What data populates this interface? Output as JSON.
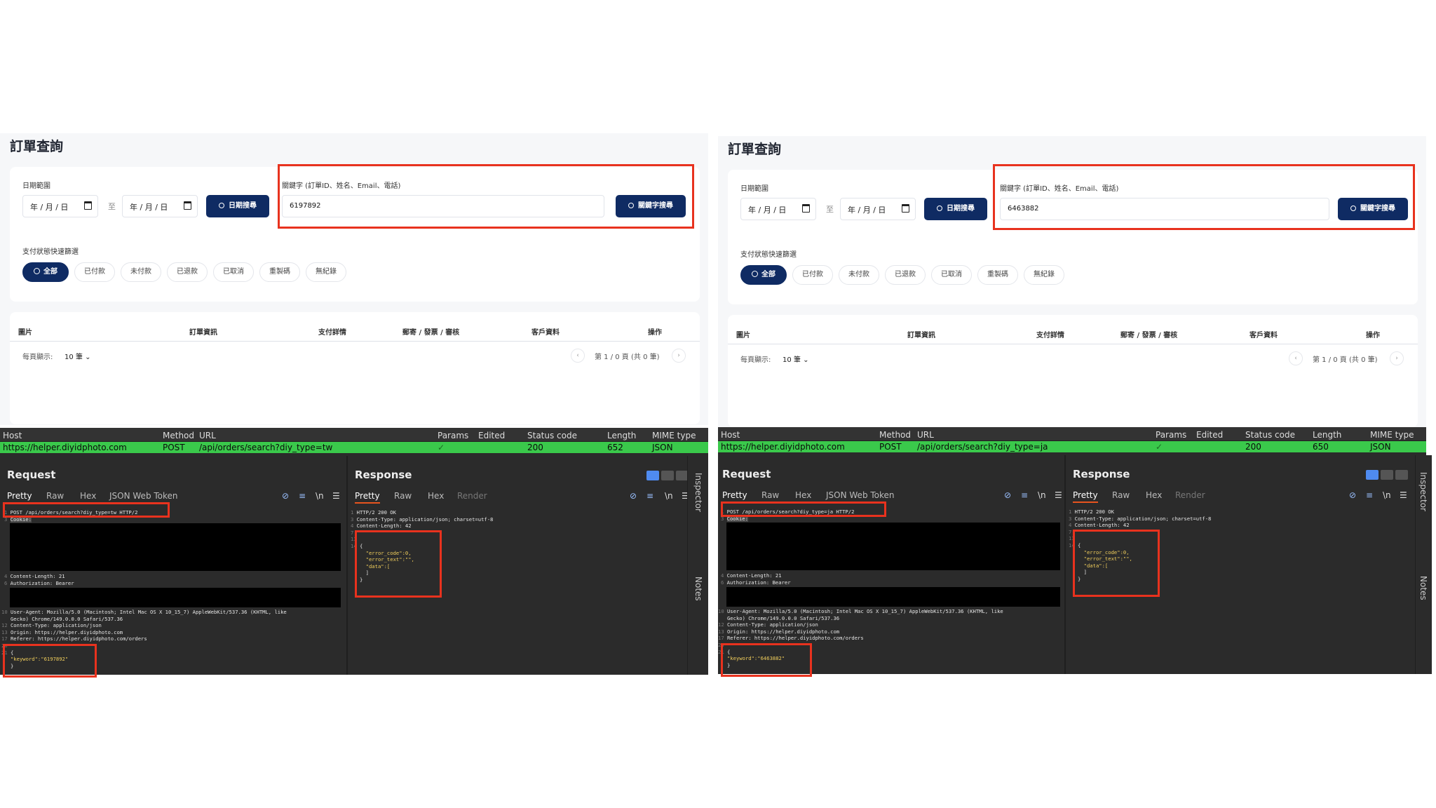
{
  "left": {
    "page_title": "訂單查詢",
    "date_range_label": "日期範圍",
    "date_from": "年 / 月 / 日",
    "date_to": "年 / 月 / 日",
    "range_sep": "至",
    "date_search_btn": "日期搜尋",
    "keyword_label": "關鍵字 (訂單ID、姓名、Email、電話)",
    "keyword_value": "6197892",
    "keyword_search_btn": "關鍵字搜尋",
    "status_filter_label": "支付狀態快速篩選",
    "chips": [
      "全部",
      "已付款",
      "未付款",
      "已退款",
      "已取消",
      "重製碼",
      "無紀錄"
    ],
    "table_headers": [
      "圖片",
      "訂單資訊",
      "支付詳情",
      "郵寄 / 發票 / 審核",
      "客戶資料",
      "操作"
    ],
    "per_page_label": "每頁顯示:",
    "per_page_value": "10 筆",
    "pager_text": "第 1 / 0 頁 (共 0 筆)",
    "grid_headers": [
      "Host",
      "Method",
      "URL",
      "Params",
      "Edited",
      "Status code",
      "Length",
      "MIME type"
    ],
    "grid_row": {
      "host": "https://helper.diyidphoto.com",
      "method": "POST",
      "url": "/api/orders/search?diy_type=tw",
      "params": "✓",
      "status": "200",
      "length": "652",
      "mime": "JSON"
    },
    "request_title": "Request",
    "response_title": "Response",
    "req_tabs": [
      "Pretty",
      "Raw",
      "Hex",
      "JSON Web Token"
    ],
    "resp_tabs": [
      "Pretty",
      "Raw",
      "Hex",
      "Render"
    ],
    "newline_icon": "\\n",
    "req_line1": "POST /api/orders/search?diy_type=tw HTTP/2",
    "req_cookie": "Cookie:",
    "req_len": "Content-Length: 21",
    "req_auth": "Authorization: Bearer",
    "req_ua": "User-Agent: Mozilla/5.0 (Macintosh; Intel Mac OS X 10_15_7) AppleWebKit/537.36 (KHTML, like",
    "req_ua2": "Gecko) Chrome/149.0.0.0 Safari/537.36",
    "req_ct": "Content-Type: application/json",
    "req_origin": "Origin: https://helper.diyidphoto.com",
    "req_referer": "Referer: https://helper.diyidphoto.com/orders",
    "req_body_key": "\"keyword\":\"6197892\"",
    "resp_status": "HTTP/2 200 OK",
    "resp_ct": "Content-Type: application/json; charset=utf-8",
    "resp_len": "Content-Length: 42",
    "resp_err_code": "\"error_code\":0,",
    "resp_err_text": "\"error_text\":\"\",",
    "resp_data": "\"data\":[",
    "inspector": "Inspector",
    "notes": "Notes"
  },
  "right": {
    "page_title": "訂單查詢",
    "date_range_label": "日期範圍",
    "date_from": "年 / 月 / 日",
    "date_to": "年 / 月 / 日",
    "range_sep": "至",
    "date_search_btn": "日期搜尋",
    "keyword_label": "關鍵字 (訂單ID、姓名、Email、電話)",
    "keyword_value": "6463882",
    "keyword_search_btn": "關鍵字搜尋",
    "status_filter_label": "支付狀態快速篩選",
    "chips": [
      "全部",
      "已付款",
      "未付款",
      "已退款",
      "已取消",
      "重製碼",
      "無紀錄"
    ],
    "table_headers": [
      "圖片",
      "訂單資訊",
      "支付詳情",
      "郵寄 / 發票 / 審核",
      "客戶資料",
      "操作"
    ],
    "per_page_label": "每頁顯示:",
    "per_page_value": "10 筆",
    "pager_text": "第 1 / 0 頁 (共 0 筆)",
    "grid_headers": [
      "Host",
      "Method",
      "URL",
      "Params",
      "Edited",
      "Status code",
      "Length",
      "MIME type"
    ],
    "grid_row": {
      "host": "https://helper.diyidphoto.com",
      "method": "POST",
      "url": "/api/orders/search?diy_type=ja",
      "params": "✓",
      "status": "200",
      "length": "650",
      "mime": "JSON"
    },
    "request_title": "Request",
    "response_title": "Response",
    "req_tabs": [
      "Pretty",
      "Raw",
      "Hex",
      "JSON Web Token"
    ],
    "resp_tabs": [
      "Pretty",
      "Raw",
      "Hex",
      "Render"
    ],
    "newline_icon": "\\n",
    "req_line1": "POST /api/orders/search?diy_type=ja HTTP/2",
    "req_cookie": "Cookie:",
    "req_len": "Content-Length: 21",
    "req_auth": "Authorization: Bearer",
    "req_ua": "User-Agent: Mozilla/5.0 (Macintosh; Intel Mac OS X 10_15_7) AppleWebKit/537.36 (KHTML, like",
    "req_ua2": "Gecko) Chrome/149.0.0.0 Safari/537.36",
    "req_ct": "Content-Type: application/json",
    "req_origin": "Origin: https://helper.diyidphoto.com",
    "req_referer": "Referer: https://helper.diyidphoto.com/orders",
    "req_body_key": "\"keyword\":\"6463882\"",
    "resp_status": "HTTP/2 200 OK",
    "resp_ct": "Content-Type: application/json; charset=utf-8",
    "resp_len": "Content-Length: 42",
    "resp_err_code": "\"error_code\":0,",
    "resp_err_text": "\"error_text\":\"\",",
    "resp_data": "\"data\":[",
    "inspector": "Inspector",
    "notes": "Notes"
  },
  "colors": {
    "accent": "#0f2b63",
    "highlight": "#e8321e",
    "row_green": "#3ac94b",
    "burp_bg": "#2b2b2b"
  }
}
